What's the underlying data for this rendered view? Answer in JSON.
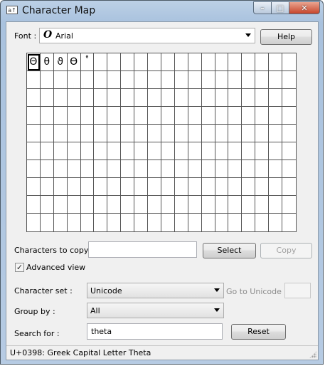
{
  "window": {
    "title": "Character Map",
    "icon": "charmap-app-icon"
  },
  "title_buttons": {
    "minimize": "–",
    "maximize": "□",
    "close": "✕"
  },
  "font": {
    "label": "Font :",
    "value": "Arial",
    "font_glyph": "O"
  },
  "help_button": "Help",
  "grid": {
    "columns": 20,
    "rows": 10,
    "characters": [
      "Θ",
      "θ",
      "ϑ",
      "ϴ",
      "ᶿ"
    ]
  },
  "copy_row": {
    "label": "Characters to copy",
    "value": "",
    "select_label": "Select",
    "copy_label": "Copy"
  },
  "advanced_view": {
    "label": "Advanced view",
    "checked": true,
    "check_glyph": "✓"
  },
  "character_set": {
    "label": "Character set :",
    "value": "Unicode"
  },
  "goto_unicode": {
    "label": "Go to Unicode :",
    "value": ""
  },
  "group_by": {
    "label": "Group by :",
    "value": "All"
  },
  "search": {
    "label": "Search for :",
    "value": "theta",
    "reset_label": "Reset"
  },
  "status": "U+0398: Greek Capital Letter Theta"
}
